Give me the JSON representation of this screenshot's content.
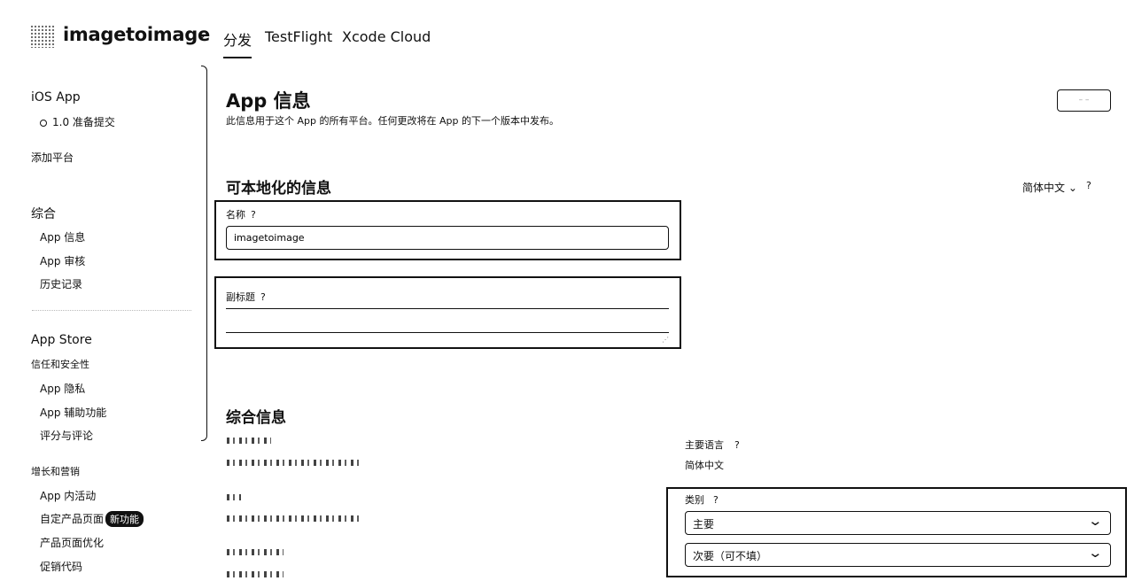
{
  "header": {
    "app_name": "imagetoimage",
    "tabs": [
      "分发",
      "TestFlight",
      "Xcode Cloud"
    ]
  },
  "sidebar": {
    "ios_app": "iOS App",
    "version": "1.0 准备提交",
    "add_platform": "添加平台",
    "general": "综合",
    "general_items": [
      "App 信息",
      "App 审核",
      "历史记录"
    ],
    "app_store": "App Store",
    "trust_safety": "信任和安全性",
    "trust_items": [
      "App 隐私",
      "App 辅助功能",
      "评分与评论"
    ],
    "growth": "增长和营销",
    "growth_items": [
      "App 内活动",
      "自定产品页面",
      "产品页面优化",
      "促销代码"
    ],
    "new_badge": "新功能"
  },
  "main": {
    "title": "App 信息",
    "description": "此信息用于这个 App 的所有平台。任何更改将在 App 的下一个版本中发布。",
    "localizable_title": "可本地化的信息",
    "language": "简体中文",
    "help_mark": "?",
    "name_label": "名称",
    "name_value": "imagetoimage",
    "subtitle_label": "副标题",
    "subtitle_value": "",
    "general_info_title": "综合信息",
    "primary_language_label": "主要语言",
    "primary_language_value": "简体中文",
    "category_label": "类别",
    "category_primary": "主要",
    "category_secondary": "次要（可不填）"
  },
  "colors": {
    "text": "#111111",
    "background": "#ffffff",
    "badge": "#111111"
  },
  "icons": [
    "app-logo-icon",
    "chevron-down-icon",
    "help-icon",
    "status-circle-icon"
  ]
}
